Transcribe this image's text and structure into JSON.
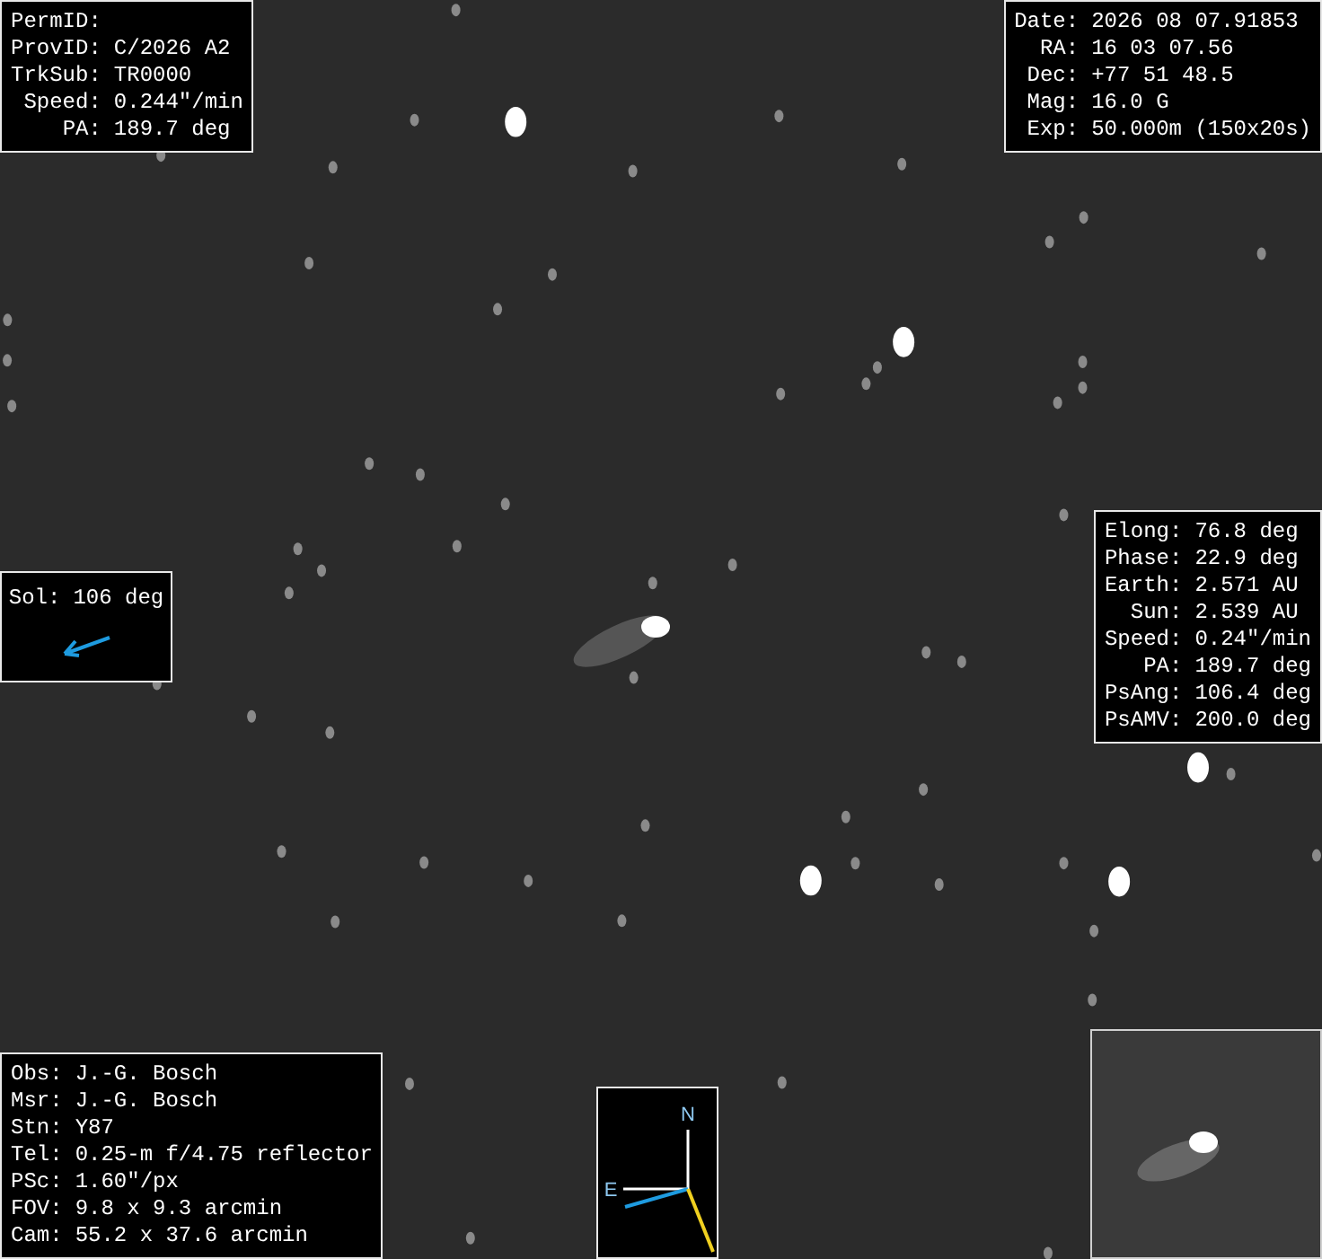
{
  "object_panel": [
    {
      "label": "PermID:"
    },
    {
      "label": "ProvID:",
      "value": "C/2026 A2"
    },
    {
      "label": "TrkSub:",
      "value": "TR0000"
    },
    {
      "label": "Speed:",
      "value": "0.244\"/min"
    },
    {
      "label": "PA:",
      "value": "189.7 deg"
    }
  ],
  "exposure_panel": [
    {
      "label": "Date:",
      "value": "2026 08 07.91853"
    },
    {
      "label": "RA:",
      "value": "16 03 07.56"
    },
    {
      "label": "Dec:",
      "value": "+77 51 48.5"
    },
    {
      "label": "Mag:",
      "value": "16.0 G"
    },
    {
      "label": "Exp:",
      "value": "50.000m (150x20s)"
    }
  ],
  "geometry_panel": [
    {
      "label": "Elong:",
      "value": "76.8 deg"
    },
    {
      "label": "Phase:",
      "value": "22.9 deg"
    },
    {
      "label": "Earth:",
      "value": "2.571 AU"
    },
    {
      "label": "Sun:",
      "value": "2.539 AU"
    },
    {
      "label": "Speed:",
      "value": "0.24\"/min"
    },
    {
      "label": "PA:",
      "value": "189.7 deg"
    },
    {
      "label": "PsAng:",
      "value": "106.4 deg"
    },
    {
      "label": "PsAMV:",
      "value": "200.0 deg"
    }
  ],
  "sun_direction": {
    "label": "Sol:",
    "value": "106 deg"
  },
  "site_panel": [
    {
      "label": "Obs:",
      "value": "J.-G. Bosch"
    },
    {
      "label": "Msr:",
      "value": "J.-G. Bosch"
    },
    {
      "label": "Stn:",
      "value": "Y87"
    },
    {
      "label": "Tel:",
      "value": "0.25-m f/4.75 reflector"
    },
    {
      "label": "PSc:",
      "value": "1.60\"/px"
    },
    {
      "label": "FOV:",
      "value": "9.8 x 9.3 arcmin"
    },
    {
      "label": "Cam:",
      "value": "55.2 x 37.6 arcmin"
    }
  ],
  "compass": {
    "north": "N",
    "east": "E"
  }
}
